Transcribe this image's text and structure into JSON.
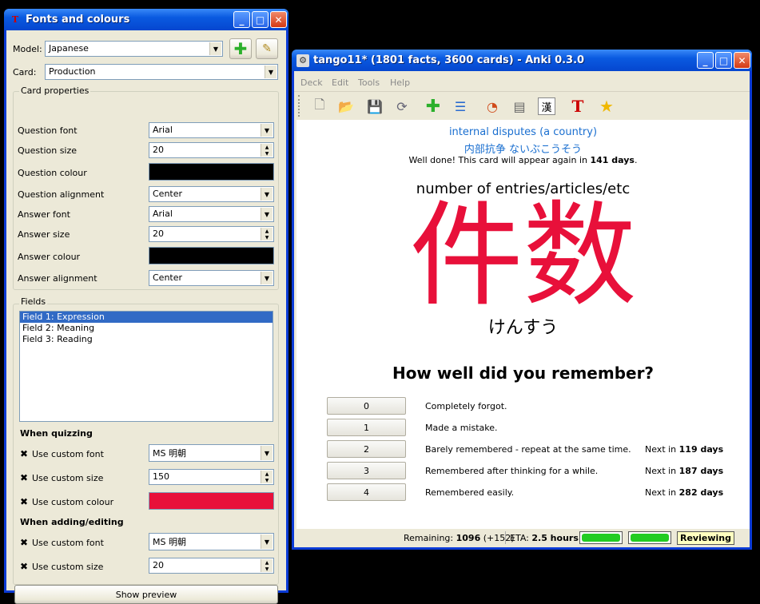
{
  "fonts_window": {
    "title": "Fonts and colours",
    "model_label": "Model:",
    "model_value": "Japanese",
    "card_label": "Card:",
    "card_value": "Production",
    "card_props_title": "Card properties",
    "rows": [
      {
        "label": "Question font",
        "value": "Arial",
        "kind": "combo"
      },
      {
        "label": "Question size",
        "value": "20",
        "kind": "spin"
      },
      {
        "label": "Question colour",
        "value": "#000000",
        "kind": "color"
      },
      {
        "label": "Question alignment",
        "value": "Center",
        "kind": "combo"
      },
      {
        "label": "Answer font",
        "value": "Arial",
        "kind": "combo"
      },
      {
        "label": "Answer size",
        "value": "20",
        "kind": "spin"
      },
      {
        "label": "Answer colour",
        "value": "#000000",
        "kind": "color"
      },
      {
        "label": "Answer alignment",
        "value": "Center",
        "kind": "combo"
      }
    ],
    "fields_title": "Fields",
    "fields": [
      "Field 1: Expression",
      "Field 2: Meaning",
      "Field 3: Reading"
    ],
    "quizzing_title": "When quizzing",
    "quiz_font_label": "Use custom font",
    "quiz_font_value": "MS 明朝",
    "quiz_size_label": "Use custom size",
    "quiz_size_value": "150",
    "quiz_colour_label": "Use custom colour",
    "quiz_colour_value": "#e8103a",
    "adding_title": "When adding/editing",
    "add_font_label": "Use custom font",
    "add_font_value": "MS 明朝",
    "add_size_label": "Use custom size",
    "add_size_value": "20",
    "check_mark": "✖",
    "preview_button": "Show preview"
  },
  "anki_window": {
    "title": "tango11* (1801 facts, 3600 cards) - Anki 0.3.0",
    "menu": [
      "Deck",
      "Edit",
      "Tools",
      "Help"
    ],
    "prev_answer": "internal disputes (a country)",
    "prev_reading": "内部抗争 ないぶこうそう",
    "done_msg_pre": "Well done! This card will appear again in ",
    "done_msg_days": "141 days",
    "done_msg_post": ".",
    "question": "number of entries/articles/etc",
    "kanji": "件数",
    "reading": "けんすう",
    "prompt": "How well did you remember?",
    "answers": [
      {
        "btn": "0",
        "text": "Completely forgot.",
        "next_pre": "",
        "next_days": ""
      },
      {
        "btn": "1",
        "text": "Made a mistake.",
        "next_pre": "",
        "next_days": ""
      },
      {
        "btn": "2",
        "text": "Barely remembered - repeat at the same time.",
        "next_pre": "Next in ",
        "next_days": "119 days"
      },
      {
        "btn": "3",
        "text": "Remembered after thinking for a while.",
        "next_pre": "Next in ",
        "next_days": "187 days"
      },
      {
        "btn": "4",
        "text": "Remembered easily.",
        "next_pre": "Next in ",
        "next_days": "282 days"
      }
    ],
    "status": {
      "remaining_label": "Remaining: ",
      "remaining_value": "1096",
      "remaining_extra": " (+152)",
      "eta_label": "ETA: ",
      "eta_value": "2.5 hours",
      "progress1": 1.0,
      "progress2": 1.0,
      "mode": "Reviewing"
    },
    "colors": {
      "link": "#1a6fd0",
      "kanji": "#e8103a",
      "progress": "#22cc22"
    }
  }
}
